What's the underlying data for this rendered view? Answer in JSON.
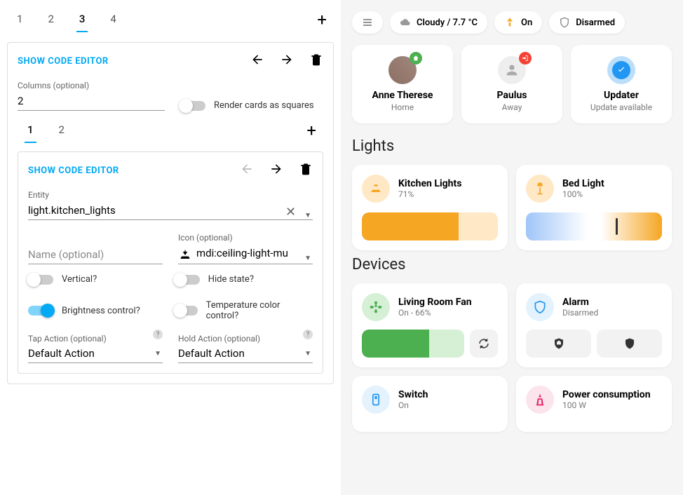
{
  "tabs_outer": [
    "1",
    "2",
    "3",
    "4"
  ],
  "active_outer": "3",
  "show_code": "SHOW CODE EDITOR",
  "columns_label": "Columns (optional)",
  "columns_value": "2",
  "render_squares": "Render cards as squares",
  "tabs_inner": [
    "1",
    "2"
  ],
  "active_inner": "1",
  "entity_label": "Entity",
  "entity_value": "light.kitchen_lights",
  "name_label": "Name (optional)",
  "icon_label": "Icon (optional)",
  "icon_value": "mdi:ceiling-light-mu",
  "toggles": {
    "vertical": "Vertical?",
    "brightness": "Brightness control?",
    "hide_state": "Hide state?",
    "temp_color": "Temperature color control?"
  },
  "tap_action_label": "Tap Action (optional)",
  "hold_action_label": "Hold Action (optional)",
  "default_action": "Default Action",
  "chips": {
    "weather": "Cloudy / 7.7 °C",
    "light_state": "On",
    "alarm_state": "Disarmed"
  },
  "people": [
    {
      "name": "Anne Therese",
      "state": "Home",
      "badge": "home",
      "badge_color": "#4caf50"
    },
    {
      "name": "Paulus",
      "state": "Away",
      "badge": "away",
      "badge_color": "#f44336"
    },
    {
      "name": "Updater",
      "state": "Update available",
      "badge": "check",
      "badge_color": "#2196f3"
    }
  ],
  "sections": {
    "lights": "Lights",
    "devices": "Devices"
  },
  "lights": [
    {
      "name": "Kitchen Lights",
      "pct": "71%",
      "fill": 71
    },
    {
      "name": "Bed Light",
      "pct": "100%",
      "fill": 100,
      "gradient": true,
      "marker": 66
    }
  ],
  "devices": {
    "fan": {
      "name": "Living Room Fan",
      "state": "On - 66%",
      "fill": 66
    },
    "alarm": {
      "name": "Alarm",
      "state": "Disarmed"
    },
    "switch": {
      "name": "Switch",
      "state": "On"
    },
    "power": {
      "name": "Power consumption",
      "state": "100 W"
    }
  }
}
